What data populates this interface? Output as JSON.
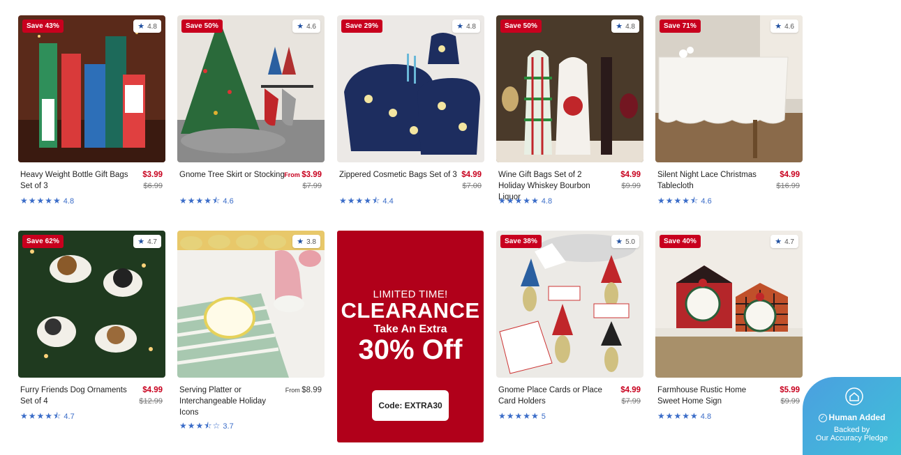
{
  "products": [
    {
      "name": "Heavy Weight Bottle Gift Bags Set of 3",
      "price": "$3.99",
      "price_prefix": "",
      "was": "$6.99",
      "save": "Save 43%",
      "badge_rating": "4.8",
      "rating": "4.8",
      "stars": "★★★★★"
    },
    {
      "name": "Gnome Tree Skirt or Stocking",
      "price": "$3.99",
      "price_prefix": "From ",
      "was": "$7.99",
      "save": "Save 50%",
      "badge_rating": "4.6",
      "rating": "4.6",
      "stars": "★★★★⯪"
    },
    {
      "name": "Zippered Cosmetic Bags Set of 3",
      "price": "$4.99",
      "price_prefix": "",
      "was": "$7.00",
      "save": "Save 29%",
      "badge_rating": "4.8",
      "rating": "4.4",
      "stars": "★★★★⯪"
    },
    {
      "name": "Wine Gift Bags Set of 2 Holiday Whiskey Bourbon Liquor",
      "price": "$4.99",
      "price_prefix": "",
      "was": "$9.99",
      "save": "Save 50%",
      "badge_rating": "4.8",
      "rating": "4.8",
      "stars": "★★★★★"
    },
    {
      "name": "Silent Night Lace Christmas Tablecloth",
      "price": "$4.99",
      "price_prefix": "",
      "was": "$16.99",
      "save": "Save 71%",
      "badge_rating": "4.6",
      "rating": "4.6",
      "stars": "★★★★⯪"
    },
    {
      "name": "Furry Friends Dog Ornaments Set of 4",
      "price": "$4.99",
      "price_prefix": "",
      "was": "$12.99",
      "save": "Save 62%",
      "badge_rating": "4.7",
      "rating": "4.7",
      "stars": "★★★★⯪"
    },
    {
      "name": "Serving Platter or Interchangeable Holiday Icons",
      "price": "$8.99",
      "price_prefix": "From ",
      "was": "",
      "save": "",
      "badge_rating": "3.8",
      "rating": "3.7",
      "stars": "★★★⯪☆"
    },
    {
      "name": "Gnome Place Cards or Place Card Holders",
      "price": "$4.99",
      "price_prefix": "",
      "was": "$7.99",
      "save": "Save 38%",
      "badge_rating": "5.0",
      "rating": "5",
      "stars": "★★★★★"
    },
    {
      "name": "Farmhouse Rustic Home Sweet Home Sign",
      "price": "$5.99",
      "price_prefix": "",
      "was": "$9.99",
      "save": "Save 40%",
      "badge_rating": "4.7",
      "rating": "4.8",
      "stars": "★★★★★"
    }
  ],
  "promo": {
    "line1": "LIMITED TIME!",
    "line2": "CLEARANCE",
    "line3": "Take An Extra",
    "line4": "30% Off",
    "code": "Code: EXTRA30"
  },
  "pledge": {
    "title": "Human Added",
    "line1": "Backed by",
    "line2": "Our Accuracy Pledge"
  },
  "colors": {
    "sale_red": "#c8001e",
    "promo_bg": "#b1001a",
    "star_blue": "#3a6cc8",
    "pledge_gradient": [
      "#4b9fe0",
      "#3fc0d8"
    ]
  }
}
